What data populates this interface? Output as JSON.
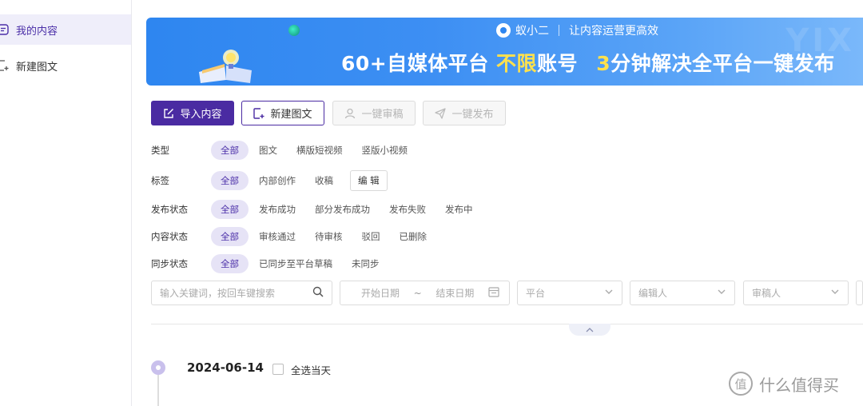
{
  "sidebar": {
    "items": [
      {
        "label": "我的内容",
        "icon": "document-list-icon",
        "active": true
      },
      {
        "label": "新建图文",
        "icon": "add-doc-icon",
        "active": false
      }
    ]
  },
  "banner": {
    "brand": "蚁小二",
    "slogan": "让内容运营更高效",
    "headline_part1": "60+自媒体平台",
    "headline_highlight1": "不限",
    "headline_part2": "账号",
    "headline_highlight2": "3",
    "headline_part3": "分钟解决全平台一键发布",
    "accent_color": "#ffe14d"
  },
  "toolbar": {
    "import_label": "导入内容",
    "new_label": "新建图文",
    "audit_label": "一键审稿",
    "publish_label": "一键发布",
    "primary_color": "#4a2ba2"
  },
  "filters": [
    {
      "label": "类型",
      "options": [
        "全部",
        "图文",
        "横版短视频",
        "竖版小视频"
      ],
      "selected": "全部"
    },
    {
      "label": "标签",
      "options": [
        "全部",
        "内部创作",
        "收稿"
      ],
      "selected": "全部",
      "edit_label": "编 辑"
    },
    {
      "label": "发布状态",
      "options": [
        "全部",
        "发布成功",
        "部分发布成功",
        "发布失败",
        "发布中"
      ],
      "selected": "全部"
    },
    {
      "label": "内容状态",
      "options": [
        "全部",
        "审核通过",
        "待审核",
        "驳回",
        "已删除"
      ],
      "selected": "全部"
    },
    {
      "label": "同步状态",
      "options": [
        "全部",
        "已同步至平台草稿",
        "未同步"
      ],
      "selected": "全部"
    }
  ],
  "search": {
    "keyword_placeholder": "输入关键词，按回车键搜索",
    "start_date_placeholder": "开始日期",
    "date_separator": "~",
    "end_date_placeholder": "结束日期",
    "platform_placeholder": "平台",
    "editor_placeholder": "编辑人",
    "auditor_placeholder": "审稿人"
  },
  "timeline": {
    "date": "2024-06-14",
    "select_all_label": "全选当天"
  },
  "watermark": {
    "text": "什么值得买",
    "logo_char": "值"
  }
}
